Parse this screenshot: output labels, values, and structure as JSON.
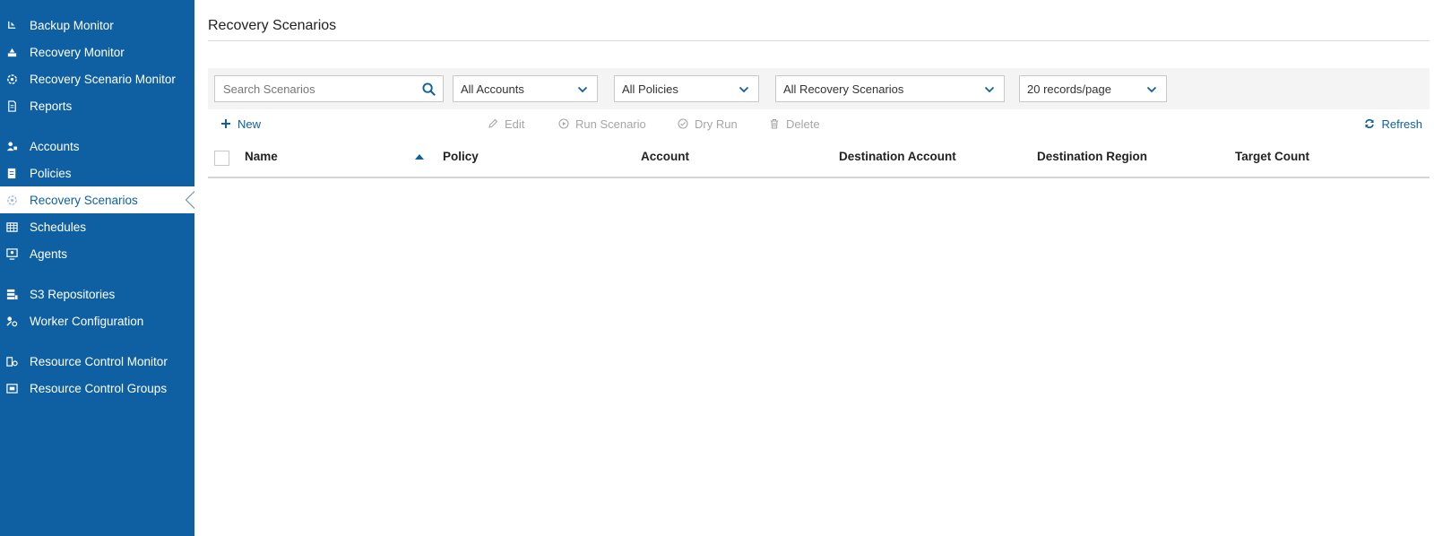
{
  "sidebar": {
    "items": [
      {
        "label": "Backup Monitor",
        "icon": "backup-monitor-icon"
      },
      {
        "label": "Recovery Monitor",
        "icon": "recovery-monitor-icon"
      },
      {
        "label": "Recovery Scenario Monitor",
        "icon": "recovery-scenario-monitor-icon"
      },
      {
        "label": "Reports",
        "icon": "reports-icon"
      },
      {
        "label": "Accounts",
        "icon": "accounts-icon"
      },
      {
        "label": "Policies",
        "icon": "policies-icon"
      },
      {
        "label": "Recovery Scenarios",
        "icon": "recovery-scenarios-icon",
        "active": true
      },
      {
        "label": "Schedules",
        "icon": "schedules-icon"
      },
      {
        "label": "Agents",
        "icon": "agents-icon"
      },
      {
        "label": "S3 Repositories",
        "icon": "s3-repositories-icon"
      },
      {
        "label": "Worker Configuration",
        "icon": "worker-configuration-icon"
      },
      {
        "label": "Resource Control Monitor",
        "icon": "resource-control-monitor-icon"
      },
      {
        "label": "Resource Control Groups",
        "icon": "resource-control-groups-icon"
      }
    ]
  },
  "page": {
    "title": "Recovery Scenarios"
  },
  "filters": {
    "search_placeholder": "Search Scenarios",
    "accounts": "All Accounts",
    "policies": "All Policies",
    "scenarios": "All Recovery Scenarios",
    "page_size": "20 records/page"
  },
  "toolbar": {
    "new": "New",
    "edit": "Edit",
    "run_scenario": "Run Scenario",
    "dry_run": "Dry Run",
    "delete": "Delete",
    "refresh": "Refresh"
  },
  "table": {
    "columns": [
      "Name",
      "Policy",
      "Account",
      "Destination Account",
      "Destination Region",
      "Target Count"
    ]
  },
  "colors": {
    "sidebar": "#0e60a3",
    "accent": "#0e60a3",
    "disabled": "#a6a6a6"
  }
}
